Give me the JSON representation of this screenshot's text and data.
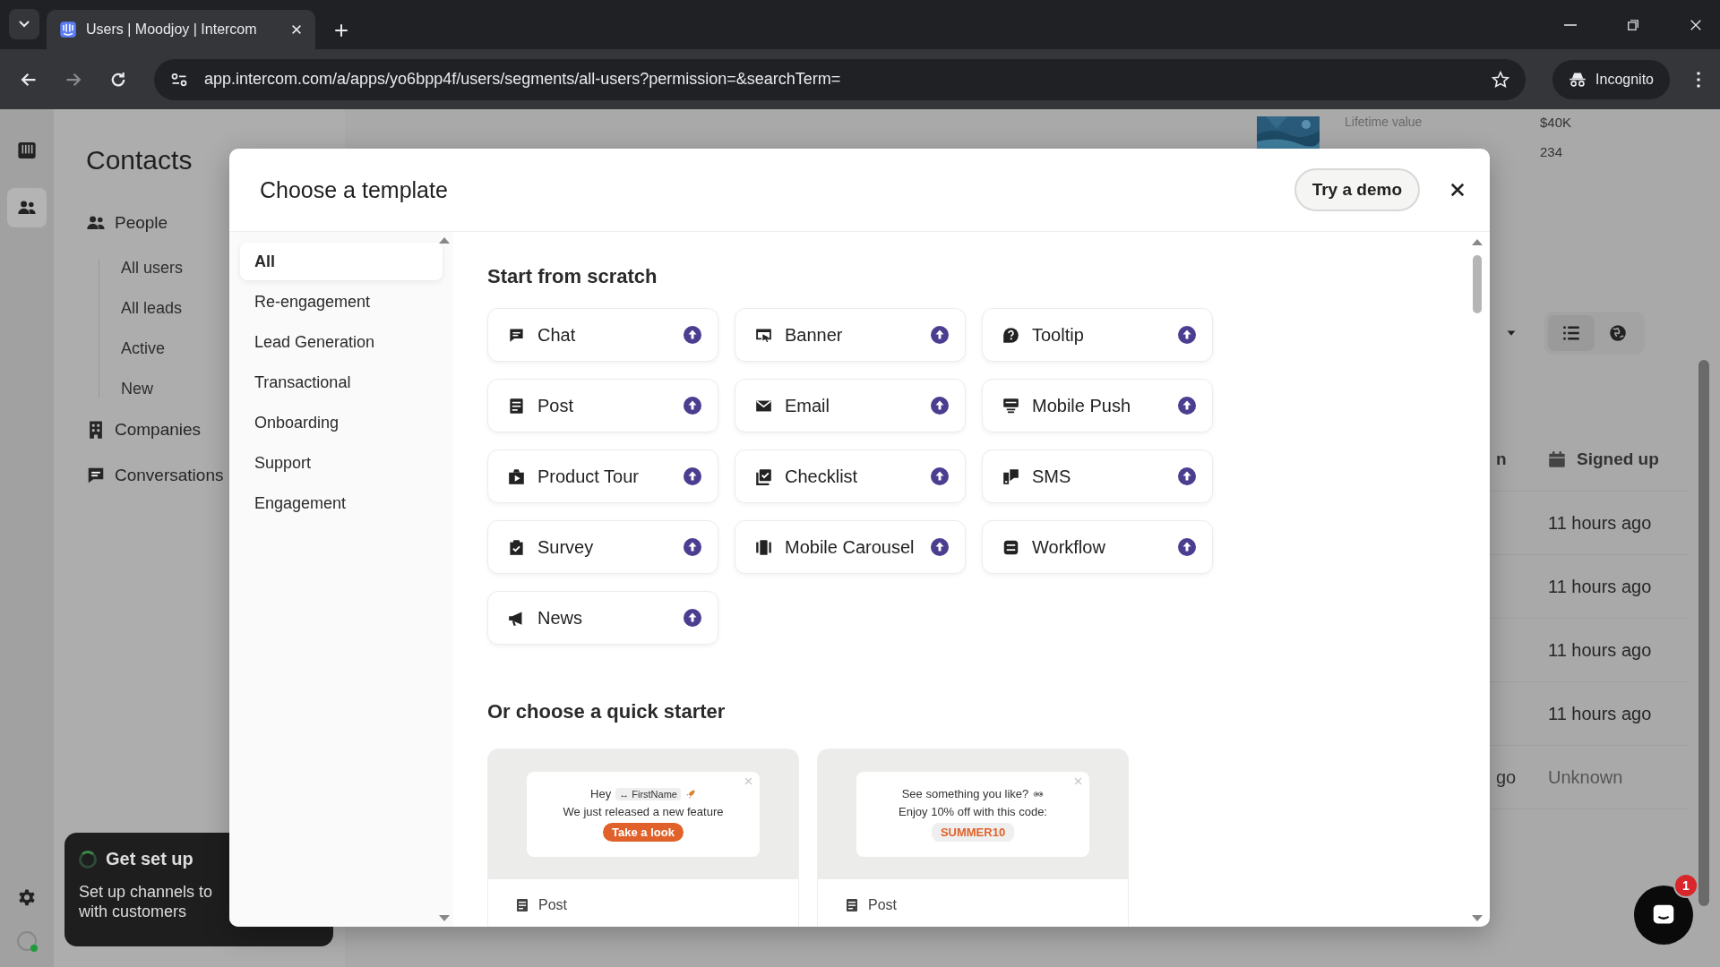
{
  "browser": {
    "tab_title": "Users | Moodjoy | Intercom",
    "url": "app.intercom.com/a/apps/yo6bpp4f/users/segments/all-users?permission=&searchTerm=",
    "incognito": "Incognito"
  },
  "rail": [
    {
      "kind": "inbox",
      "selected": false
    },
    {
      "kind": "people",
      "selected": true
    }
  ],
  "sidebar": {
    "title": "Contacts",
    "sections": [
      {
        "label": "People",
        "kind": "people",
        "children": [
          "All users",
          "All leads",
          "Active",
          "New"
        ]
      },
      {
        "label": "Companies",
        "kind": "building"
      },
      {
        "label": "Conversations",
        "kind": "chat"
      }
    ]
  },
  "setup_card": {
    "title": "Get set up",
    "lines": [
      "Set up channels to",
      "with customers"
    ]
  },
  "summary": {
    "label": "Lifetime value",
    "values": [
      "$40K",
      "234"
    ]
  },
  "table": {
    "column_1": "n",
    "column_2": "Signed up",
    "rows": [
      {
        "signed_up": "11 hours ago"
      },
      {
        "signed_up": "11 hours ago"
      },
      {
        "signed_up": "11 hours ago"
      },
      {
        "signed_up": "11 hours ago"
      },
      {
        "column_1": "go",
        "signed_up": "Unknown",
        "muted": true
      }
    ]
  },
  "messenger": {
    "badge": "1"
  },
  "modal": {
    "title": "Choose a template",
    "demo_button": "Try a demo",
    "categories": [
      {
        "label": "All",
        "selected": true
      },
      {
        "label": "Re-engagement",
        "selected": false
      },
      {
        "label": "Lead Generation",
        "selected": false
      },
      {
        "label": "Transactional",
        "selected": false
      },
      {
        "label": "Onboarding",
        "selected": false
      },
      {
        "label": "Support",
        "selected": false
      },
      {
        "label": "Engagement",
        "selected": false
      }
    ],
    "scratch_title": "Start from scratch",
    "items": [
      {
        "label": "Chat",
        "kind": "chat"
      },
      {
        "label": "Banner",
        "kind": "banner"
      },
      {
        "label": "Tooltip",
        "kind": "tooltip"
      },
      {
        "label": "Post",
        "kind": "post"
      },
      {
        "label": "Email",
        "kind": "email"
      },
      {
        "label": "Mobile Push",
        "kind": "push"
      },
      {
        "label": "Product Tour",
        "kind": "tour"
      },
      {
        "label": "Checklist",
        "kind": "checklist"
      },
      {
        "label": "SMS",
        "kind": "sms"
      },
      {
        "label": "Survey",
        "kind": "survey"
      },
      {
        "label": "Mobile Carousel",
        "kind": "carousel"
      },
      {
        "label": "Workflow",
        "kind": "workflow"
      },
      {
        "label": "News",
        "kind": "news"
      }
    ],
    "starter_title": "Or choose a quick starter",
    "starters": [
      {
        "kind": "announcement",
        "greeting": "Hey",
        "token": "↔ FirstName",
        "line": "We just released a new feature",
        "button": "Take a look",
        "type": "Post"
      },
      {
        "kind": "offer",
        "line": "See something you like?",
        "line_2": "Enjoy 10% off with this code:",
        "code": "SUMMER10",
        "type": "Post"
      }
    ]
  }
}
